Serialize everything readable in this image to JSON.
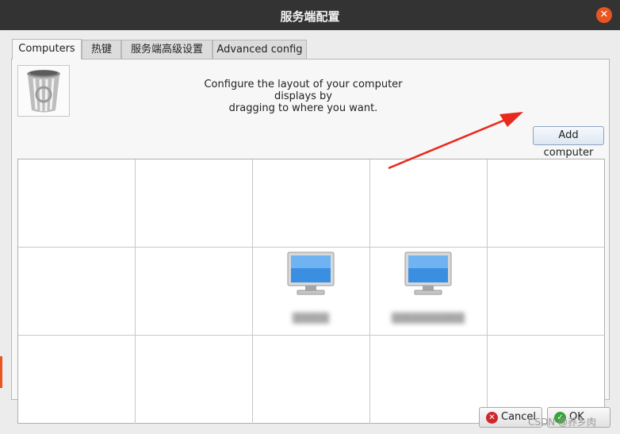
{
  "window": {
    "title": "服务端配置"
  },
  "tabs": [
    {
      "label": "Computers"
    },
    {
      "label": "热键"
    },
    {
      "label": "服务端高级设置"
    },
    {
      "label": "Advanced config"
    }
  ],
  "computers_tab": {
    "instructions": "Configure the layout of your computer displays by\ndragging to where you want.",
    "add_computer_label": "Add computer",
    "screens": [
      {
        "name": "▒▒▒▒▒"
      },
      {
        "name": "▒▒▒▒▒▒▒▒▒▒"
      }
    ]
  },
  "footer": {
    "cancel_label": "Cancel",
    "ok_label": "OK"
  },
  "watermark": "CSDN @养乡肉",
  "colors": {
    "titlebar": "#333333",
    "close": "#e95420",
    "annotation_arrow": "#e8291c"
  }
}
